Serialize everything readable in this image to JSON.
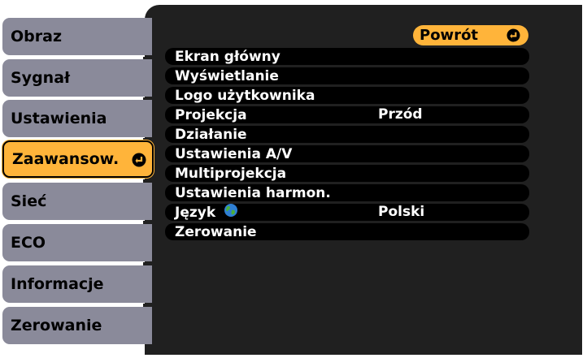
{
  "sidebar": {
    "items": [
      {
        "label": "Obraz"
      },
      {
        "label": "Sygnał"
      },
      {
        "label": "Ustawienia"
      },
      {
        "label": "Zaawansow."
      },
      {
        "label": "Sieć"
      },
      {
        "label": "ECO"
      },
      {
        "label": "Informacje"
      },
      {
        "label": "Zerowanie"
      }
    ],
    "selected_index": 3
  },
  "panel": {
    "return_label": "Powrót",
    "items": [
      {
        "label": "Ekran główny",
        "value": ""
      },
      {
        "label": "Wyświetlanie",
        "value": ""
      },
      {
        "label": "Logo użytkownika",
        "value": ""
      },
      {
        "label": "Projekcja",
        "value": "Przód"
      },
      {
        "label": "Działanie",
        "value": ""
      },
      {
        "label": "Ustawienia A/V",
        "value": ""
      },
      {
        "label": "Multiprojekcja",
        "value": ""
      },
      {
        "label": "Ustawienia harmon.",
        "value": ""
      },
      {
        "label": "Język",
        "value": "Polski"
      },
      {
        "label": "Zerowanie",
        "value": ""
      }
    ]
  },
  "colors": {
    "panel_bg": "#202020",
    "tab_bg": "#8a8a9a",
    "accent": "#ffb43a",
    "item_bg": "#000000",
    "text_light": "#ffffff"
  },
  "icons": {
    "enter": "enter-return-icon",
    "language": "globe-icon"
  }
}
